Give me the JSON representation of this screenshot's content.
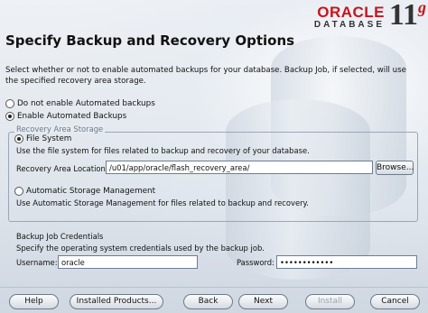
{
  "header": {
    "logo_oracle": "ORACLE",
    "logo_database": "DATABASE",
    "version": "11",
    "version_suffix": "g",
    "title": "Specify Backup and Recovery Options"
  },
  "description": "Select whether or not to enable automated backups for your database. Backup Job, if selected, will use the specified recovery area storage.",
  "backup_options": [
    {
      "label": "Do not enable Automated backups",
      "selected": false
    },
    {
      "label": "Enable Automated Backups",
      "selected": true
    }
  ],
  "recovery_storage": {
    "legend": "Recovery Area Storage",
    "file_system": {
      "label": "File System",
      "selected": true,
      "description": "Use the file system for files related to backup and recovery of your database.",
      "location_label": "Recovery Area Location:",
      "location_value": "/u01/app/oracle/flash_recovery_area/",
      "browse_label": "Browse..."
    },
    "asm": {
      "label": "Automatic Storage Management",
      "selected": false,
      "description": "Use Automatic Storage Management for files related to backup and recovery."
    }
  },
  "credentials": {
    "heading": "Backup Job Credentials",
    "description": "Specify the operating system credentials used by the backup job.",
    "username_label": "Username:",
    "username_value": "oracle",
    "password_label": "Password:",
    "password_value": "••••••••••••"
  },
  "buttons": {
    "help": "Help",
    "installed_products": "Installed Products...",
    "back": "Back",
    "next": "Next",
    "install": "Install",
    "cancel": "Cancel"
  }
}
